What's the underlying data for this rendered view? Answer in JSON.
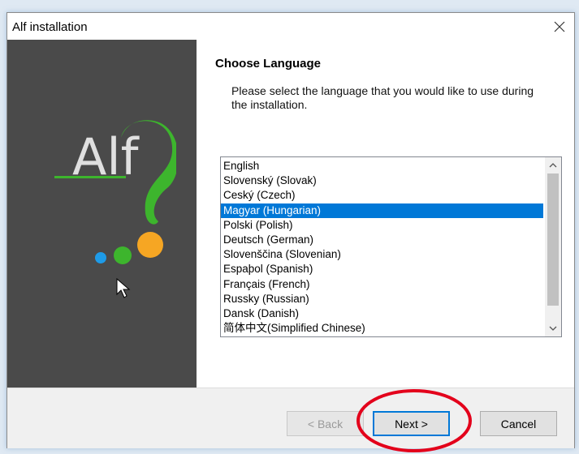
{
  "window": {
    "title": "Alf installation"
  },
  "logo": {
    "text": "Alf"
  },
  "page": {
    "heading": "Choose Language",
    "description": "Please select the language that you would like to use during the installation."
  },
  "languages": [
    "English",
    "Slovenský (Slovak)",
    "Ceský (Czech)",
    "Magyar (Hungarian)",
    "Polski (Polish)",
    "Deutsch (German)",
    "Slovenščina (Slovenian)",
    "Espaþol (Spanish)",
    "Français (French)",
    "Russky (Russian)",
    "Dansk (Danish)",
    "简体中文(Simplified Chinese)"
  ],
  "selected_language": "Magyar (Hungarian)",
  "buttons": {
    "back": "< Back",
    "next": "Next >",
    "cancel": "Cancel"
  },
  "colors": {
    "selection": "#0078d7",
    "side_panel": "#4a4a4a",
    "logo_green": "#3db52d",
    "dot_blue": "#1e9be8",
    "dot_orange": "#f6a623",
    "annotation": "#e3001b"
  },
  "icons": {
    "close": "close-icon",
    "scroll_up": "chevron-up-icon",
    "scroll_down": "chevron-down-icon"
  }
}
